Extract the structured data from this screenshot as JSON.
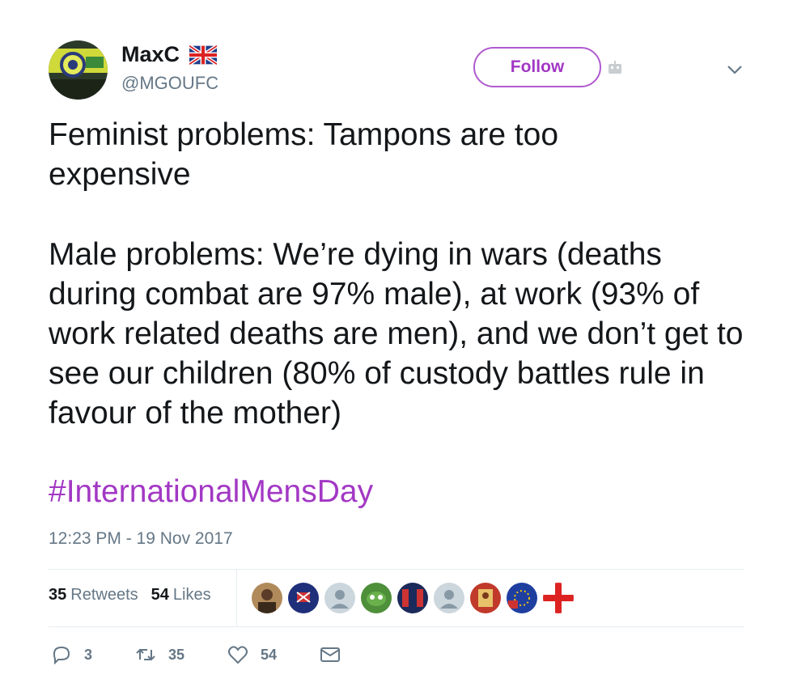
{
  "user": {
    "display_name": "MaxC",
    "handle": "@MGOUFC",
    "flag_icon": "uk-flag-icon"
  },
  "follow_button": {
    "label": "Follow"
  },
  "tweet": {
    "paragraph_1": "Feminist problems: Tampons are too expensive",
    "paragraph_2": "Male problems: We’re dying in wars (deaths during combat are 97% male), at work (93% of work related deaths are men), and we don’t get to see our children (80% of custody battles rule in favour of the mother)",
    "hashtag": "#InternationalMensDay",
    "timestamp": "12:23 PM - 19 Nov 2017"
  },
  "stats": {
    "retweets_count": "35",
    "retweets_label": "Retweets",
    "likes_count": "54",
    "likes_label": "Likes"
  },
  "actions": {
    "reply_count": "3",
    "retweet_count": "35",
    "like_count": "54"
  },
  "colors": {
    "accent": "#a238c4",
    "secondary_text": "#657786",
    "divider": "#e6ecf0"
  }
}
